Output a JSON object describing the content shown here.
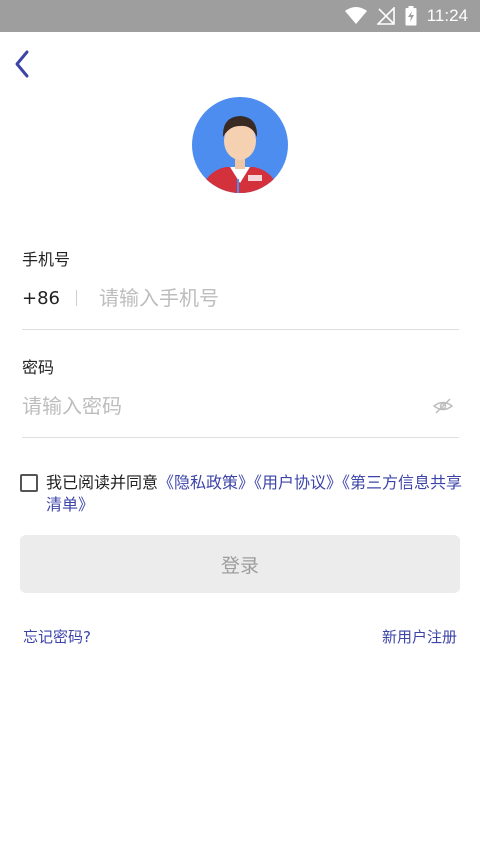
{
  "status_bar": {
    "time": "11:24"
  },
  "form": {
    "phone_label": "手机号",
    "country_code": "+86",
    "phone_placeholder": "请输入手机号",
    "password_label": "密码",
    "password_placeholder": "请输入密码"
  },
  "agreement": {
    "prefix": "我已阅读并同意",
    "links": [
      "《隐私政策》",
      "《用户协议》",
      "《第三方信息共享清单》"
    ]
  },
  "login_button": "登录",
  "footer": {
    "forgot": "忘记密码?",
    "register": "新用户注册"
  },
  "colors": {
    "accent": "#3d44a8",
    "avatar_bg": "#4d8df0",
    "button_bg": "#ececed",
    "status_bar": "#9e9e9e"
  },
  "icons": [
    "wifi-icon",
    "signal-icon",
    "battery-icon",
    "back-chevron-icon",
    "eye-hidden-icon"
  ]
}
